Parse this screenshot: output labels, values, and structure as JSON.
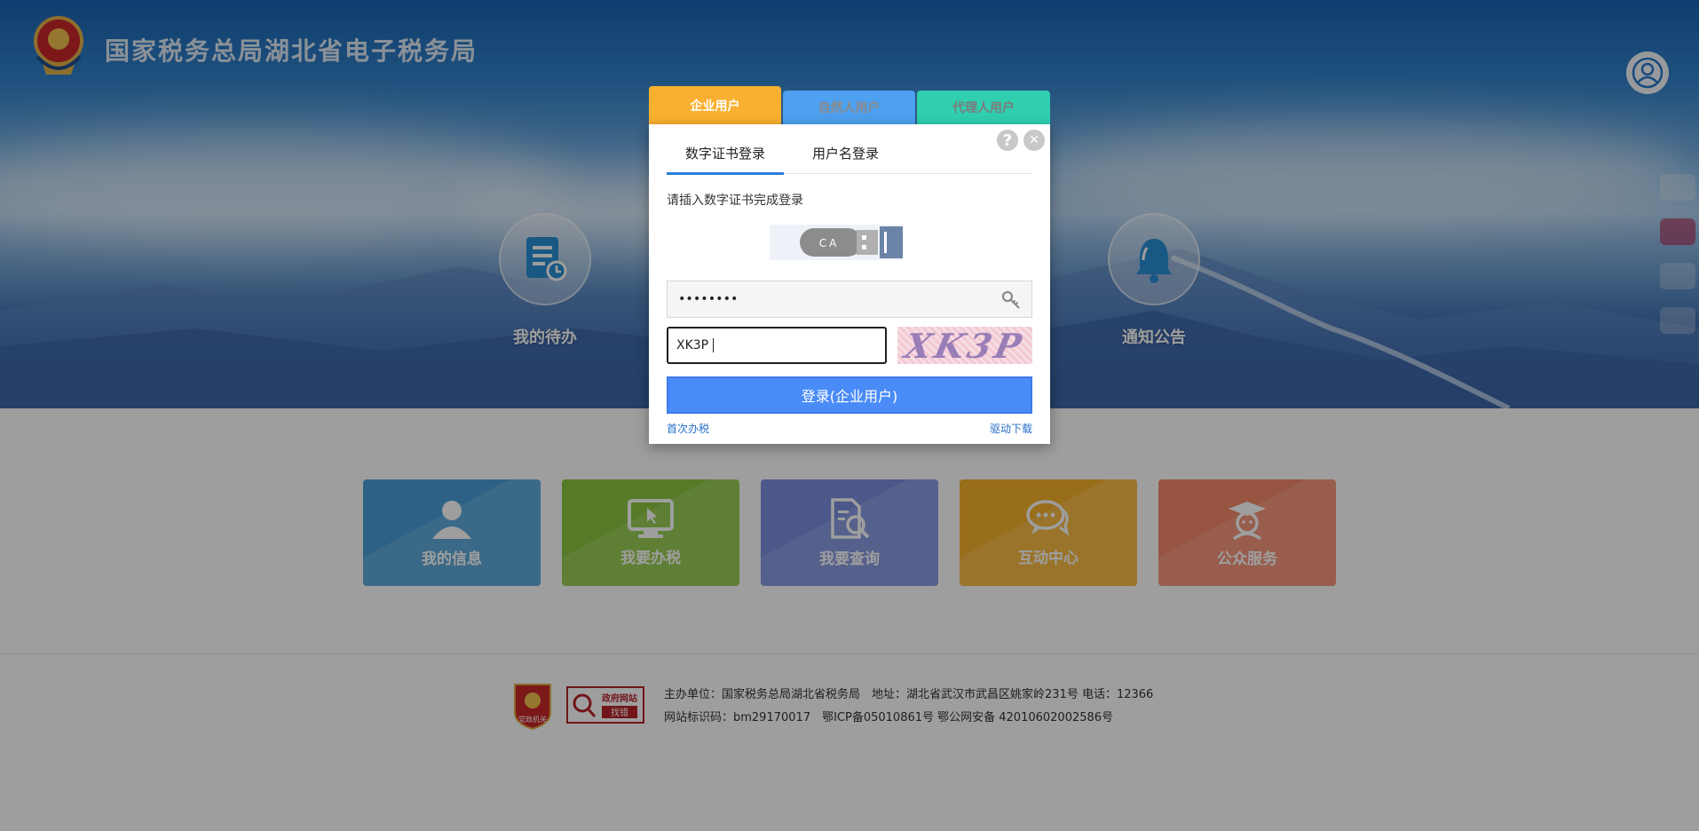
{
  "header": {
    "site_title": "国家税务总局湖北省电子税务局"
  },
  "hero": {
    "items": [
      {
        "label": "我的待办",
        "icon": "todo-list-icon"
      },
      {
        "label": "通知公告",
        "icon": "bell-icon"
      }
    ]
  },
  "menu": {
    "tiles": [
      {
        "label": "我的信息",
        "color": "#4a9fd8",
        "icon": "user-icon"
      },
      {
        "label": "我要办税",
        "color": "#8cc63f",
        "icon": "monitor-icon"
      },
      {
        "label": "我要查询",
        "color": "#7b8fde",
        "icon": "search-document-icon"
      },
      {
        "label": "互动中心",
        "color": "#f7b22b",
        "icon": "chat-icon"
      },
      {
        "label": "公众服务",
        "color": "#f4896a",
        "icon": "graduate-icon"
      }
    ]
  },
  "footer": {
    "line1": "主办单位：国家税务总局湖北省税务局　地址：湖北省武汉市武昌区姚家岭231号  电话：12366",
    "line2": "网站标识码：bm29170017　鄂ICP备05010861号  鄂公网安备 42010602002586号",
    "badge_text": "党政机关",
    "gov_text_top": "政府网站",
    "gov_text_bottom": "找错"
  },
  "login": {
    "user_tabs": [
      {
        "label": "企业用户",
        "color": "#f9b030",
        "text_color": "#ffffff",
        "active": true
      },
      {
        "label": "自然人用户",
        "color": "#4ea0f0",
        "text_color": "#8a8a8a",
        "active": false
      },
      {
        "label": "代理人用户",
        "color": "#2fcfb0",
        "text_color": "#7c7c7c",
        "active": false
      }
    ],
    "subtabs": [
      "数字证书登录",
      "用户名登录"
    ],
    "instruction": "请插入数字证书完成登录",
    "ca_label": "CA",
    "password_value": "••••••••",
    "captcha_value": "XK3P",
    "captcha_image_text": "XK3P",
    "login_button": "登录(企业用户)",
    "first_time_link": "首次办税",
    "driver_link": "驱动下载",
    "help_icon_text": "?",
    "close_icon_text": "✕"
  }
}
